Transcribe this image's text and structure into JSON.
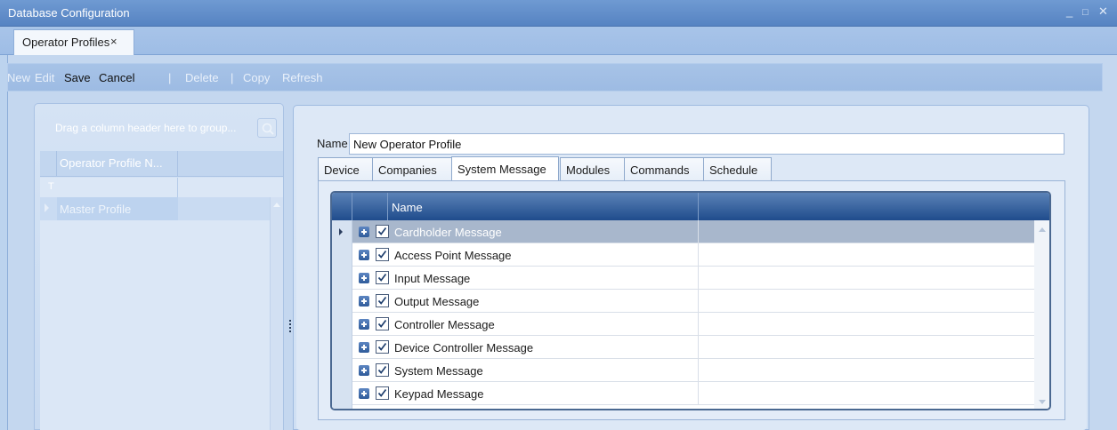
{
  "window": {
    "title": "Database Configuration",
    "controls": {
      "minimize": "_",
      "maximize": "□",
      "close": "✕"
    }
  },
  "doc_tab": {
    "label": "Operator Profiles",
    "close": "×"
  },
  "toolbar": {
    "new": "New",
    "edit": "Edit",
    "save": "Save",
    "cancel": "Cancel",
    "sep1": "|",
    "delete": "Delete",
    "sep2": "|",
    "copy": "Copy",
    "refresh": "Refresh"
  },
  "left_panel": {
    "group_hint": "Drag a column header here to group...",
    "column_header": "Operator Profile N...",
    "filter_icon": "T",
    "rows": [
      "Master Profile"
    ]
  },
  "form": {
    "name_label": "Name",
    "name_value": "New Operator Profile"
  },
  "tabs": [
    {
      "label": "Device"
    },
    {
      "label": "Companies"
    },
    {
      "label": "System Message",
      "active": true
    },
    {
      "label": "Modules"
    },
    {
      "label": "Commands"
    },
    {
      "label": "Schedule"
    }
  ],
  "message_grid": {
    "column_header": "Name",
    "rows": [
      {
        "label": "Cardholder Message",
        "checked": true,
        "selected": true
      },
      {
        "label": "Access Point Message",
        "checked": true
      },
      {
        "label": "Input Message",
        "checked": true
      },
      {
        "label": "Output Message",
        "checked": true
      },
      {
        "label": "Controller Message",
        "checked": true
      },
      {
        "label": "Device Controller Message",
        "checked": true
      },
      {
        "label": "System Message",
        "checked": true
      },
      {
        "label": "Keypad Message",
        "checked": true
      }
    ]
  },
  "colors": {
    "title_bar": "#5d88c6",
    "grid_header": "#2f5c9a",
    "selected_row": "#a8b7cc",
    "background": "#bcd3ee"
  }
}
